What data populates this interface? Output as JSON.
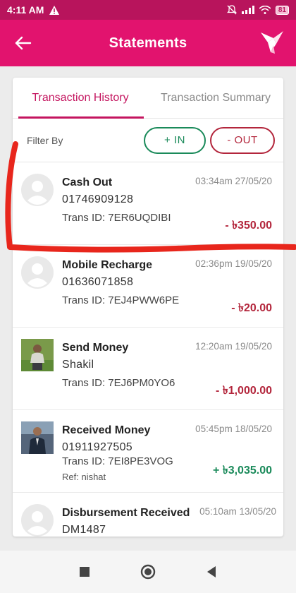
{
  "status_bar": {
    "time": "4:11 AM",
    "battery": "81"
  },
  "app_bar": {
    "title": "Statements"
  },
  "tabs": [
    {
      "label": "Transaction History",
      "active": true
    },
    {
      "label": "Transaction Summary",
      "active": false
    }
  ],
  "filter": {
    "label": "Filter By",
    "in_label": "+ IN",
    "out_label": "- OUT"
  },
  "transactions": [
    {
      "title": "Cash Out",
      "subtitle": "01746909128",
      "trans_id": "Trans ID: 7ER6UQDIBI",
      "datetime": "03:34am 27/05/20",
      "amount": "- ৳350.00",
      "direction": "out",
      "avatar": "placeholder-avatar-icon"
    },
    {
      "title": "Mobile Recharge",
      "subtitle": "01636071858",
      "trans_id": "Trans ID: 7EJ4PWW6PE",
      "datetime": "02:36pm 19/05/20",
      "amount": "- ৳20.00",
      "direction": "out",
      "avatar": "placeholder-avatar-icon"
    },
    {
      "title": "Send Money",
      "subtitle": "Shakil",
      "trans_id": "Trans ID: 7EJ6PM0YO6",
      "datetime": "12:20am 19/05/20",
      "amount": "- ৳1,000.00",
      "direction": "out",
      "avatar": "photo"
    },
    {
      "title": "Received Money",
      "subtitle": "01911927505",
      "trans_id": "Trans ID: 7EI8PE3VOG",
      "ref": "Ref: nishat",
      "datetime": "05:45pm 18/05/20",
      "amount": "+ ৳3,035.00",
      "direction": "in",
      "avatar": "photo"
    },
    {
      "title": "Disbursement Received",
      "subtitle": "DM1487",
      "datetime": "05:10am 13/05/20",
      "avatar": "placeholder-avatar-icon"
    }
  ],
  "colors": {
    "brand": "#e2136e",
    "status_bar": "#b8145c",
    "in": "#1a8a5a",
    "out": "#b3263c",
    "annotation": "#e8261c"
  },
  "icons": [
    "back-arrow-icon",
    "bkash-bird-logo-icon",
    "warning-icon",
    "mute-icon",
    "signal-icon",
    "wifi-icon",
    "battery-icon",
    "square-nav-icon",
    "circle-nav-icon",
    "triangle-back-nav-icon"
  ]
}
